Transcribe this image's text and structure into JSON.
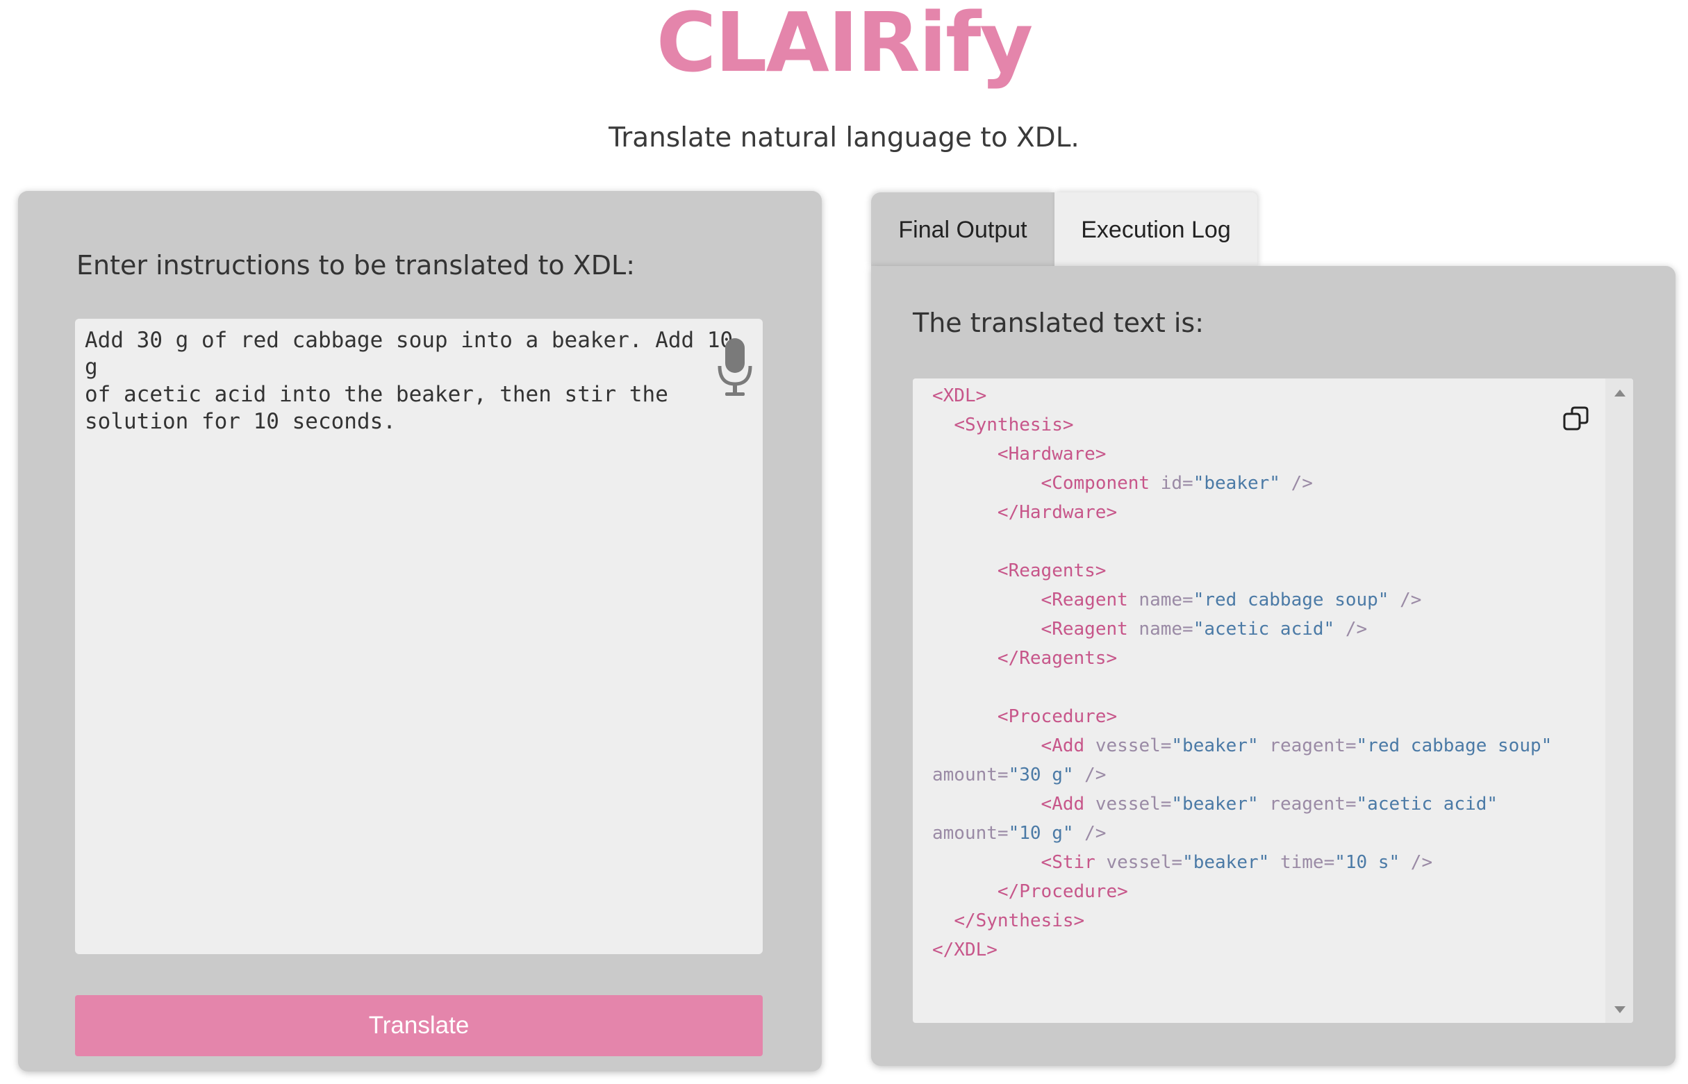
{
  "header": {
    "title": "CLAIRify",
    "subtitle": "Translate natural language to XDL."
  },
  "input_panel": {
    "label": "Enter instructions to be translated to XDL:",
    "instructions": "Add 30 g of red cabbage soup into a beaker. Add 10 g\nof acetic acid into the beaker, then stir the\nsolution for 10 seconds.",
    "mic_icon": "microphone-icon",
    "translate_label": "Translate"
  },
  "output_panel": {
    "tabs": [
      {
        "label": "Final Output",
        "active": false
      },
      {
        "label": "Execution Log",
        "active": true
      }
    ],
    "label": "The translated text is:",
    "copy_icon": "copy-icon",
    "code_lines": [
      [
        [
          "tag",
          "<XDL>"
        ]
      ],
      [
        [
          "sp",
          "  "
        ],
        [
          "tag",
          "<Synthesis>"
        ]
      ],
      [
        [
          "sp",
          "      "
        ],
        [
          "tag",
          "<Hardware>"
        ]
      ],
      [
        [
          "sp",
          "          "
        ],
        [
          "tag",
          "<Component"
        ],
        [
          "attr",
          " id="
        ],
        [
          "str",
          "\"beaker\""
        ],
        [
          "punct",
          " />"
        ]
      ],
      [
        [
          "sp",
          "      "
        ],
        [
          "tag",
          "</Hardware>"
        ]
      ],
      [],
      [
        [
          "sp",
          "      "
        ],
        [
          "tag",
          "<Reagents>"
        ]
      ],
      [
        [
          "sp",
          "          "
        ],
        [
          "tag",
          "<Reagent"
        ],
        [
          "attr",
          " name="
        ],
        [
          "str",
          "\"red cabbage soup\""
        ],
        [
          "punct",
          " />"
        ]
      ],
      [
        [
          "sp",
          "          "
        ],
        [
          "tag",
          "<Reagent"
        ],
        [
          "attr",
          " name="
        ],
        [
          "str",
          "\"acetic acid\""
        ],
        [
          "punct",
          " />"
        ]
      ],
      [
        [
          "sp",
          "      "
        ],
        [
          "tag",
          "</Reagents>"
        ]
      ],
      [],
      [
        [
          "sp",
          "      "
        ],
        [
          "tag",
          "<Procedure>"
        ]
      ],
      [
        [
          "sp",
          "          "
        ],
        [
          "tag",
          "<Add"
        ],
        [
          "attr",
          " vessel="
        ],
        [
          "str",
          "\"beaker\""
        ],
        [
          "attr",
          " reagent="
        ],
        [
          "str",
          "\"red cabbage soup\""
        ]
      ],
      [
        [
          "attr",
          "amount="
        ],
        [
          "str",
          "\"30 g\""
        ],
        [
          "punct",
          " />"
        ]
      ],
      [
        [
          "sp",
          "          "
        ],
        [
          "tag",
          "<Add"
        ],
        [
          "attr",
          " vessel="
        ],
        [
          "str",
          "\"beaker\""
        ],
        [
          "attr",
          " reagent="
        ],
        [
          "str",
          "\"acetic acid\""
        ]
      ],
      [
        [
          "attr",
          "amount="
        ],
        [
          "str",
          "\"10 g\""
        ],
        [
          "punct",
          " />"
        ]
      ],
      [
        [
          "sp",
          "          "
        ],
        [
          "tag",
          "<Stir"
        ],
        [
          "attr",
          " vessel="
        ],
        [
          "str",
          "\"beaker\""
        ],
        [
          "attr",
          " time="
        ],
        [
          "str",
          "\"10 s\""
        ],
        [
          "punct",
          " />"
        ]
      ],
      [
        [
          "sp",
          "      "
        ],
        [
          "tag",
          "</Procedure>"
        ]
      ],
      [
        [
          "sp",
          "  "
        ],
        [
          "tag",
          "</Synthesis>"
        ]
      ],
      [
        [
          "tag",
          "</XDL>"
        ]
      ]
    ]
  },
  "colors": {
    "accent": "#e485ab",
    "panel": "#cacaca",
    "field": "#eeeeee",
    "code_tag": "#c7568a",
    "code_attr": "#9a8aa5",
    "code_string": "#4b7aa6"
  }
}
